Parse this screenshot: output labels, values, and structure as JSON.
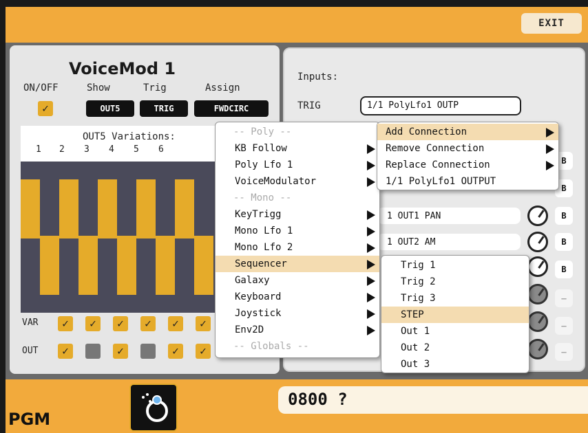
{
  "header": {
    "exit_label": "EXIT"
  },
  "module": {
    "title": "VoiceMod 1",
    "onoff_label": "ON/OFF",
    "show_label": "Show",
    "trig_label": "Trig",
    "assign_label": "Assign",
    "show_btn": "OUT5",
    "trig_btn": "TRIG",
    "assign_btn": "FWDCIRC",
    "onoff_checked": true
  },
  "grid": {
    "title": "OUT5 Variations:",
    "columns": [
      "1",
      "2",
      "3",
      "4",
      "5",
      "6"
    ],
    "step_levels": [
      "high",
      "low",
      "high",
      "low",
      "high",
      "low",
      "high",
      "low",
      "high",
      "low"
    ]
  },
  "rows": {
    "var_label": "VAR",
    "out_label": "OUT",
    "var_states": [
      true,
      true,
      true,
      true,
      true,
      true
    ],
    "out_states": [
      true,
      false,
      true,
      false,
      true,
      true
    ]
  },
  "inputs": {
    "label": "Inputs:",
    "trig_label": "TRIG",
    "trig_value": "1/1   PolyLfo1 OUTP"
  },
  "connections": [
    {
      "text": "1   OUT1 PAN",
      "button": "B"
    },
    {
      "text": "1   OUT2 AM",
      "button": "B"
    }
  ],
  "side_buttons": [
    "B",
    "B",
    "B",
    "B",
    "B",
    "–",
    "–",
    "–"
  ],
  "menu_sources": {
    "items": [
      {
        "label": "-- Poly --",
        "header": true
      },
      {
        "label": "KB Follow",
        "submenu": true
      },
      {
        "label": "Poly Lfo 1",
        "submenu": true
      },
      {
        "label": "VoiceModulator",
        "submenu": true
      },
      {
        "label": "-- Mono --",
        "header": true
      },
      {
        "label": "KeyTrigg",
        "submenu": true
      },
      {
        "label": "Mono Lfo 1",
        "submenu": true
      },
      {
        "label": "Mono Lfo 2",
        "submenu": true
      },
      {
        "label": "Sequencer",
        "submenu": true,
        "selected": true
      },
      {
        "label": "Galaxy",
        "submenu": true
      },
      {
        "label": "Keyboard",
        "submenu": true
      },
      {
        "label": "Joystick",
        "submenu": true
      },
      {
        "label": "Env2D",
        "submenu": true
      },
      {
        "label": "-- Globals --",
        "header": true
      }
    ]
  },
  "menu_actions": {
    "items": [
      {
        "label": "Add Connection",
        "submenu": true,
        "selected": true
      },
      {
        "label": "Remove Connection",
        "submenu": true
      },
      {
        "label": "Replace Connection",
        "submenu": true
      },
      {
        "label": "1/1   PolyLfo1 OUTPUT",
        "submenu": false
      }
    ]
  },
  "menu_sequencer": {
    "items": [
      {
        "label": "Trig 1"
      },
      {
        "label": "Trig 2"
      },
      {
        "label": "Trig 3"
      },
      {
        "label": "STEP",
        "selected": true
      },
      {
        "label": "Out 1"
      },
      {
        "label": "Out 2"
      },
      {
        "label": "Out 3"
      }
    ]
  },
  "footer": {
    "pgm_label": "PGM",
    "status": "0800 ?"
  },
  "colors": {
    "accent": "#f2aa3c",
    "check": "#e5ab2a",
    "step_bg": "#4a4a5a",
    "menu_highlight": "#f4dcb1"
  }
}
